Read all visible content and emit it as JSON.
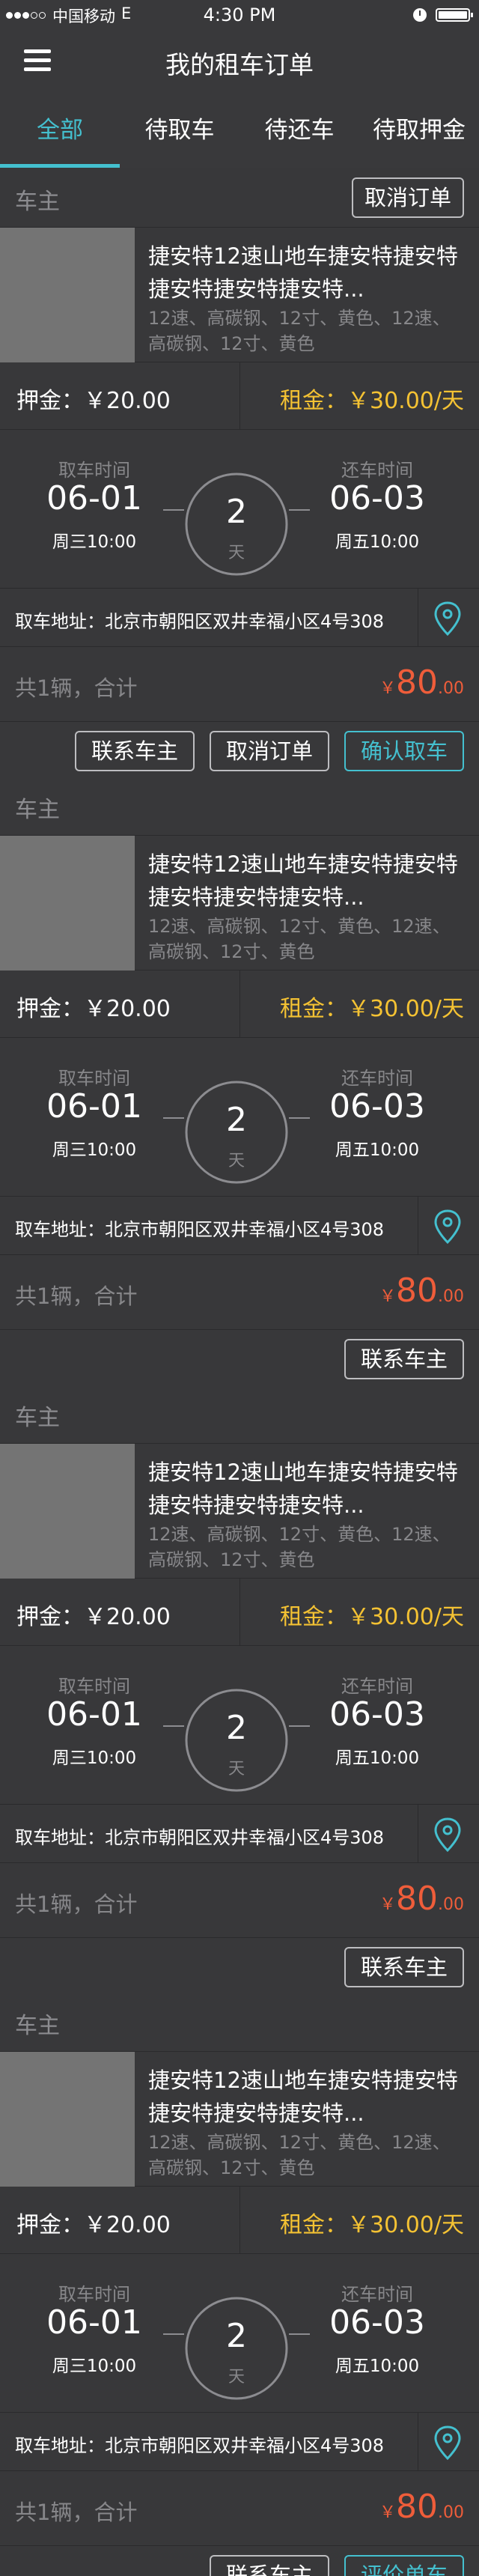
{
  "status_bar": {
    "carrier": "中国移动",
    "network": "E",
    "time": "4:30 PM"
  },
  "header": {
    "title": "我的租车订单",
    "menu_icon": "hamburger-menu-icon"
  },
  "tabs": [
    {
      "label": "全部",
      "active": true
    },
    {
      "label": "待取车",
      "active": false
    },
    {
      "label": "待还车",
      "active": false
    },
    {
      "label": "待取押金",
      "active": false
    }
  ],
  "colors": {
    "accent": "#44c0cf",
    "rent": "#f4c233",
    "total": "#ef5d3a",
    "card_bg": "#38383a",
    "page_bg": "#2e2e30"
  },
  "orders": [
    {
      "owner_label": "车主",
      "top_button": "取消订单",
      "product_name": "捷安特12速山地车捷安特捷安特捷安特捷安特捷安特...",
      "product_spec": "12速、高碳钢、12寸、黄色、12速、高碳钢、12寸、黄色",
      "deposit": "押金：￥20.00",
      "rent": "租金：￥30.00/天",
      "pickup_label": "取车时间",
      "pickup_date": "06-01",
      "pickup_weekday": "周三10:00",
      "days": "2",
      "days_unit": "天",
      "return_label": "还车时间",
      "return_date": "06-03",
      "return_weekday": "周五10:00",
      "address": "取车地址：北京市朝阳区双井幸福小区4号308",
      "quantity": "共1辆，合计",
      "currency": "￥",
      "total_int": "80",
      "total_dec": ".00",
      "actions": [
        "联系车主",
        "取消订单",
        "确认取车"
      ]
    },
    {
      "owner_label": "车主",
      "product_name": "捷安特12速山地车捷安特捷安特捷安特捷安特捷安特...",
      "product_spec": "12速、高碳钢、12寸、黄色、12速、高碳钢、12寸、黄色",
      "deposit": "押金：￥20.00",
      "rent": "租金：￥30.00/天",
      "pickup_label": "取车时间",
      "pickup_date": "06-01",
      "pickup_weekday": "周三10:00",
      "days": "2",
      "days_unit": "天",
      "return_label": "还车时间",
      "return_date": "06-03",
      "return_weekday": "周五10:00",
      "address": "取车地址：北京市朝阳区双井幸福小区4号308",
      "quantity": "共1辆，合计",
      "currency": "￥",
      "total_int": "80",
      "total_dec": ".00",
      "actions": [
        "联系车主"
      ]
    },
    {
      "owner_label": "车主",
      "product_name": "捷安特12速山地车捷安特捷安特捷安特捷安特捷安特...",
      "product_spec": "12速、高碳钢、12寸、黄色、12速、高碳钢、12寸、黄色",
      "deposit": "押金：￥20.00",
      "rent": "租金：￥30.00/天",
      "pickup_label": "取车时间",
      "pickup_date": "06-01",
      "pickup_weekday": "周三10:00",
      "days": "2",
      "days_unit": "天",
      "return_label": "还车时间",
      "return_date": "06-03",
      "return_weekday": "周五10:00",
      "address": "取车地址：北京市朝阳区双井幸福小区4号308",
      "quantity": "共1辆，合计",
      "currency": "￥",
      "total_int": "80",
      "total_dec": ".00",
      "actions": [
        "联系车主"
      ]
    },
    {
      "owner_label": "车主",
      "product_name": "捷安特12速山地车捷安特捷安特捷安特捷安特捷安特...",
      "product_spec": "12速、高碳钢、12寸、黄色、12速、高碳钢、12寸、黄色",
      "deposit": "押金：￥20.00",
      "rent": "租金：￥30.00/天",
      "pickup_label": "取车时间",
      "pickup_date": "06-01",
      "pickup_weekday": "周三10:00",
      "days": "2",
      "days_unit": "天",
      "return_label": "还车时间",
      "return_date": "06-03",
      "return_weekday": "周五10:00",
      "address": "取车地址：北京市朝阳区双井幸福小区4号308",
      "quantity": "共1辆，合计",
      "currency": "￥",
      "total_int": "80",
      "total_dec": ".00",
      "actions": [
        "联系车主",
        "评价单车"
      ]
    }
  ]
}
